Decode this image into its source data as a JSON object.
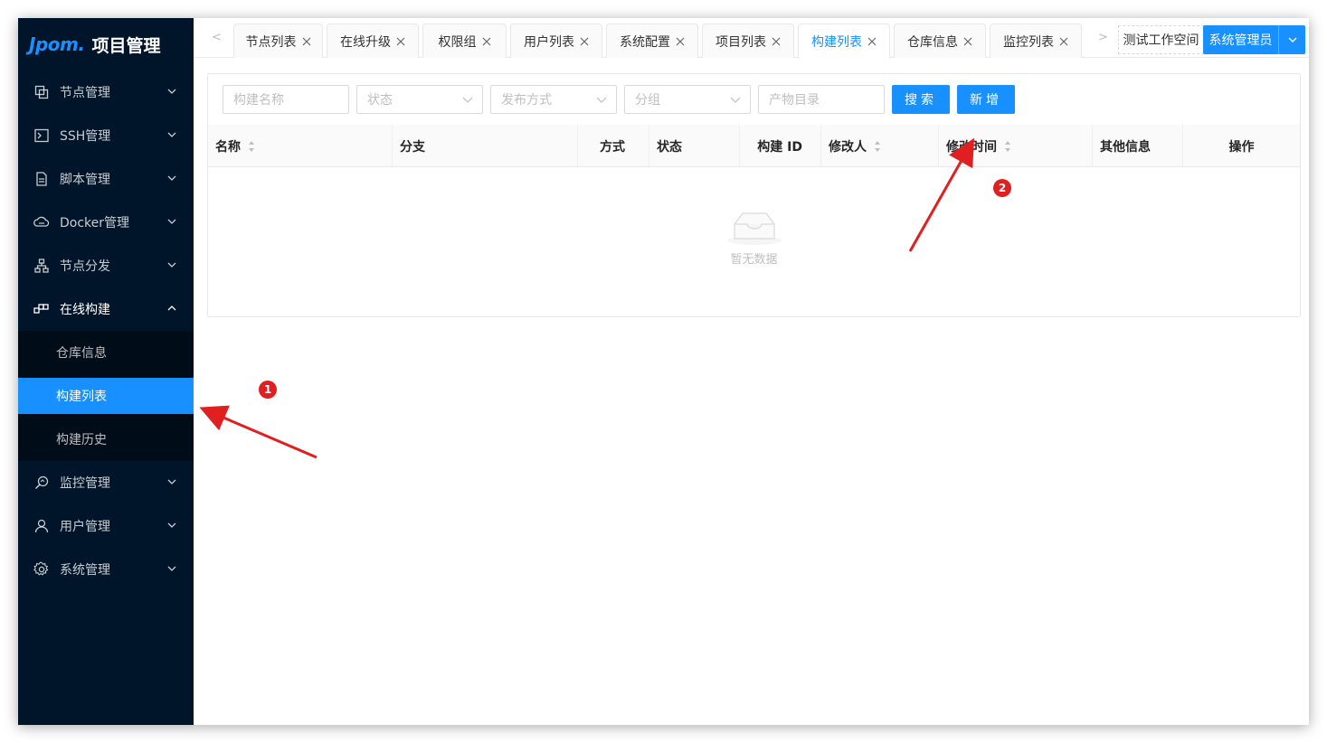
{
  "app": {
    "logo_mark": "Jpom.",
    "title": "项目管理"
  },
  "sidebar": {
    "items": [
      {
        "label": "节点管理",
        "icon": "copy-icon"
      },
      {
        "label": "SSH管理",
        "icon": "terminal-icon"
      },
      {
        "label": "脚本管理",
        "icon": "file-icon"
      },
      {
        "label": "Docker管理",
        "icon": "cloud-icon"
      },
      {
        "label": "节点分发",
        "icon": "cluster-icon"
      },
      {
        "label": "在线构建",
        "icon": "build-icon"
      },
      {
        "label": "监控管理",
        "icon": "monitor-icon"
      },
      {
        "label": "用户管理",
        "icon": "user-icon"
      },
      {
        "label": "系统管理",
        "icon": "gear-icon"
      }
    ],
    "submenu": [
      {
        "label": "仓库信息"
      },
      {
        "label": "构建列表"
      },
      {
        "label": "构建历史"
      }
    ]
  },
  "tabs": [
    {
      "label": "节点列表"
    },
    {
      "label": "在线升级"
    },
    {
      "label": "权限组"
    },
    {
      "label": "用户列表"
    },
    {
      "label": "系统配置"
    },
    {
      "label": "项目列表"
    },
    {
      "label": "构建列表"
    },
    {
      "label": "仓库信息"
    },
    {
      "label": "监控列表"
    }
  ],
  "header": {
    "workspace": "测试工作空间",
    "role": "系统管理员"
  },
  "filters": {
    "name_placeholder": "构建名称",
    "status_placeholder": "状态",
    "release_placeholder": "发布方式",
    "group_placeholder": "分组",
    "artifact_placeholder": "产物目录",
    "search_label": "搜索",
    "add_label": "新增"
  },
  "table": {
    "columns": [
      "名称",
      "分支",
      "方式",
      "状态",
      "构建 ID",
      "修改人",
      "修改时间",
      "其他信息",
      "操作"
    ],
    "empty_text": "暂无数据"
  },
  "annotations": {
    "badge_1": "1",
    "badge_2": "2",
    "color": "#e02020"
  },
  "colors": {
    "accent": "#1890ff",
    "sidebar_bg": "#001529",
    "submenu_bg": "#000c17"
  }
}
